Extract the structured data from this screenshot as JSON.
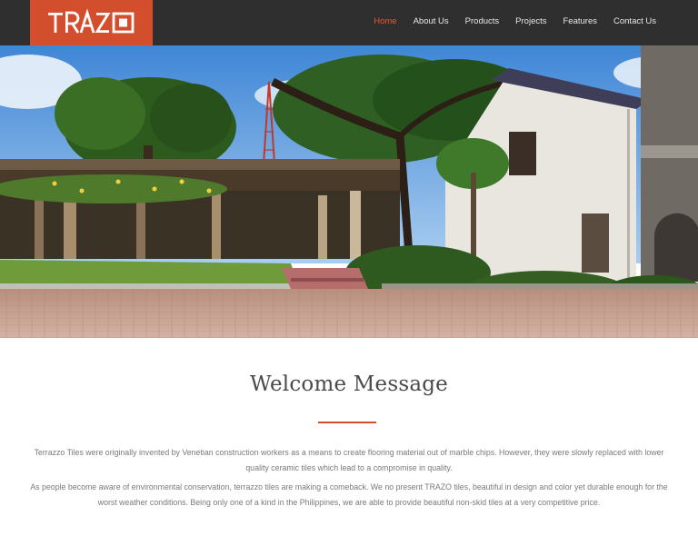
{
  "brand": {
    "logo_text": "TRAZO",
    "accent_color": "#d24e2c"
  },
  "nav": {
    "items": [
      {
        "label": "Home",
        "active": true
      },
      {
        "label": "About Us",
        "active": false
      },
      {
        "label": "Products",
        "active": false
      },
      {
        "label": "Projects",
        "active": false
      },
      {
        "label": "Features",
        "active": false
      },
      {
        "label": "Contact Us",
        "active": false
      }
    ]
  },
  "hero": {
    "image": "courtyard-photo"
  },
  "welcome": {
    "title": "Welcome Message",
    "paragraphs": [
      "Terrazzo Tiles were originally invented by Venetian construction workers as a means to create flooring material out of marble chips. However, they were slowly replaced with lower quality ceramic tiles which lead to a compromise in quality.",
      "As people become aware of environmental conservation, terrazzo tiles are making a comeback. We no present TRAZO tiles, beautiful in design and color yet durable enough for the worst weather conditions. Being only one of a kind in the Philippines, we are able to provide beautiful non-skid tiles at a very competitive price."
    ]
  }
}
